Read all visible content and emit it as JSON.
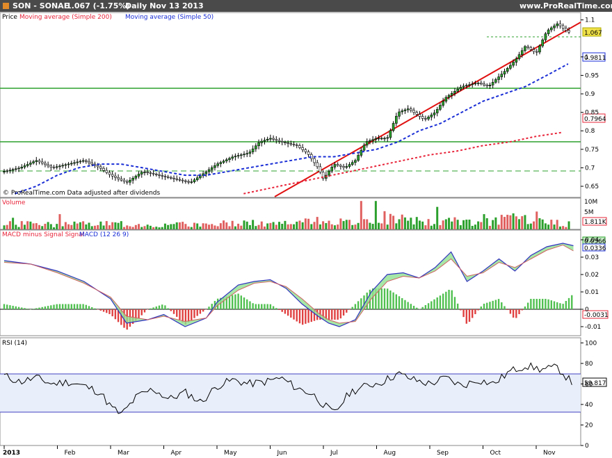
{
  "header": {
    "symbol": "SON - SONAE",
    "quote": "1.067  (-1.75%)",
    "period": "Daily  Nov 13 2013",
    "site": "www.ProRealTime.com"
  },
  "price_panel": {
    "legend_price": "Price",
    "legend_ma200": "Moving average (Simple 200)",
    "legend_ma50": "Moving average (Simple 50)",
    "footer": "© ProRealTime.com  Data adjusted after dividends",
    "last_price": "1.067",
    "ma50_value": "0.9811",
    "ma200_value": "0.7964",
    "yticks": [
      "1.1",
      "1",
      "0.95",
      "0.9",
      "0.85",
      "0.8",
      "0.75",
      "0.7",
      "0.65"
    ]
  },
  "volume_panel": {
    "label": "Volume",
    "tick_top": "10M",
    "tick_mid": "5M",
    "last_value": "1.811K"
  },
  "macd_panel": {
    "label_a": "MACD minus Signal Signal",
    "label_b": "MACD (12 26 9)",
    "value_macd": "0.0366",
    "value_signal": "0.0336",
    "value_hist": "-0.0031",
    "yticks": [
      "0.04",
      "0.03",
      "0.02",
      "0.01",
      "0",
      "-0.01"
    ]
  },
  "rsi_panel": {
    "label": "RSI (14)",
    "last_value": "59.817",
    "yticks": [
      "100",
      "80",
      "60",
      "40",
      "20",
      "0"
    ]
  },
  "x_axis": {
    "labels": [
      "2013",
      "Feb",
      "Mar",
      "Apr",
      "May",
      "Jun",
      "Jul",
      "Aug",
      "Sep",
      "Oct",
      "Nov"
    ]
  },
  "colors": {
    "up": "#2ca02c",
    "down": "#ffffff",
    "ma200": "#e8243a",
    "ma50": "#1a2ed6",
    "trend": "#e01010",
    "level": "#2ca02c",
    "panel_bg": "#e8eefa"
  },
  "chart_data": [
    {
      "type": "line",
      "panel": "price",
      "x_unit": "month of 2013 (0 = Jan 1, 10 = Nov 1)",
      "ylim": [
        0.62,
        1.12
      ],
      "series": [
        {
          "name": "Price",
          "x": [
            0,
            0.3,
            0.6,
            0.9,
            1.2,
            1.5,
            1.8,
            2.0,
            2.3,
            2.6,
            2.9,
            3.2,
            3.5,
            3.8,
            4.0,
            4.3,
            4.6,
            4.8,
            5.0,
            5.2,
            5.5,
            5.7,
            5.9,
            6.0,
            6.2,
            6.4,
            6.6,
            6.8,
            7.0,
            7.2,
            7.4,
            7.6,
            7.9,
            8.1,
            8.3,
            8.6,
            8.9,
            9.1,
            9.4,
            9.6,
            9.8,
            10.0,
            10.2,
            10.4,
            10.6
          ],
          "y": [
            0.69,
            0.7,
            0.72,
            0.7,
            0.71,
            0.72,
            0.7,
            0.68,
            0.66,
            0.69,
            0.68,
            0.67,
            0.66,
            0.69,
            0.71,
            0.73,
            0.74,
            0.77,
            0.78,
            0.77,
            0.76,
            0.74,
            0.7,
            0.67,
            0.71,
            0.7,
            0.72,
            0.77,
            0.78,
            0.78,
            0.85,
            0.86,
            0.83,
            0.85,
            0.89,
            0.92,
            0.93,
            0.92,
            0.96,
            0.99,
            1.03,
            1.01,
            1.07,
            1.09,
            1.067
          ]
        },
        {
          "name": "Moving average (Simple 50)",
          "x": [
            0.2,
            0.6,
            1.0,
            1.4,
            1.8,
            2.2,
            2.6,
            3.0,
            3.4,
            3.8,
            4.2,
            4.6,
            5.0,
            5.4,
            5.8,
            6.2,
            6.6,
            7.0,
            7.4,
            7.8,
            8.2,
            8.6,
            9.0,
            9.4,
            9.8,
            10.2,
            10.6
          ],
          "y": [
            0.63,
            0.65,
            0.68,
            0.7,
            0.71,
            0.71,
            0.7,
            0.69,
            0.68,
            0.68,
            0.69,
            0.7,
            0.71,
            0.72,
            0.73,
            0.73,
            0.74,
            0.75,
            0.77,
            0.8,
            0.82,
            0.85,
            0.88,
            0.9,
            0.92,
            0.95,
            0.981
          ]
        },
        {
          "name": "Moving average (Simple 200)",
          "x": [
            4.5,
            5.0,
            5.5,
            6.0,
            6.5,
            7.0,
            7.5,
            8.0,
            8.5,
            9.0,
            9.5,
            10.0,
            10.5
          ],
          "y": [
            0.63,
            0.645,
            0.66,
            0.675,
            0.69,
            0.705,
            0.72,
            0.735,
            0.745,
            0.76,
            0.77,
            0.785,
            0.796
          ]
        }
      ]
    },
    {
      "type": "bar",
      "panel": "volume",
      "x_unit": "month of 2013",
      "x": [
        0,
        0.5,
        1,
        1.5,
        2,
        2.5,
        3,
        3.5,
        4,
        4.5,
        5,
        5.5,
        6,
        6.5,
        7,
        7.5,
        8,
        8.5,
        9,
        9.5,
        10,
        10.5
      ],
      "values": [
        1.8,
        2.2,
        1.6,
        1.9,
        2.0,
        1.7,
        1.5,
        1.8,
        2.1,
        2.5,
        1.9,
        2.3,
        3.0,
        2.4,
        5.0,
        3.2,
        2.6,
        2.8,
        3.0,
        3.6,
        4.5,
        1.811
      ]
    },
    {
      "type": "line",
      "panel": "macd",
      "x_unit": "month of 2013",
      "ylim": [
        -0.013,
        0.042
      ],
      "series": [
        {
          "name": "MACD (12 26 9)",
          "x": [
            0,
            0.5,
            1,
            1.5,
            2,
            2.3,
            2.7,
            3,
            3.4,
            3.8,
            4,
            4.4,
            4.7,
            5,
            5.3,
            5.6,
            5.9,
            6.1,
            6.3,
            6.6,
            6.9,
            7.2,
            7.5,
            7.8,
            8.1,
            8.4,
            8.7,
            9,
            9.3,
            9.6,
            9.9,
            10.2,
            10.5,
            10.7
          ],
          "y": [
            0.028,
            0.026,
            0.022,
            0.016,
            0.006,
            -0.008,
            -0.006,
            -0.003,
            -0.01,
            -0.005,
            0.004,
            0.014,
            0.016,
            0.017,
            0.012,
            0.003,
            -0.004,
            -0.008,
            -0.01,
            -0.006,
            0.01,
            0.02,
            0.021,
            0.018,
            0.024,
            0.033,
            0.016,
            0.022,
            0.029,
            0.022,
            0.031,
            0.036,
            0.038,
            0.0366
          ]
        },
        {
          "name": "Signal",
          "x": [
            0,
            0.5,
            1,
            1.5,
            2,
            2.3,
            2.7,
            3,
            3.4,
            3.8,
            4,
            4.4,
            4.7,
            5,
            5.3,
            5.6,
            5.9,
            6.1,
            6.3,
            6.6,
            6.9,
            7.2,
            7.5,
            7.8,
            8.1,
            8.4,
            8.7,
            9,
            9.3,
            9.6,
            9.9,
            10.2,
            10.5,
            10.7
          ],
          "y": [
            0.027,
            0.026,
            0.021,
            0.015,
            0.007,
            -0.004,
            -0.006,
            -0.004,
            -0.007,
            -0.005,
            0.002,
            0.011,
            0.015,
            0.016,
            0.013,
            0.006,
            -0.002,
            -0.006,
            -0.008,
            -0.007,
            0.006,
            0.016,
            0.019,
            0.018,
            0.022,
            0.029,
            0.019,
            0.021,
            0.027,
            0.024,
            0.029,
            0.034,
            0.037,
            0.0336
          ]
        }
      ]
    },
    {
      "type": "line",
      "panel": "rsi",
      "x_unit": "month of 2013",
      "ylim": [
        0,
        100
      ],
      "levels": [
        30,
        70
      ],
      "series": [
        {
          "name": "RSI (14)",
          "x": [
            0,
            0.3,
            0.6,
            0.9,
            1.2,
            1.5,
            1.8,
            2.0,
            2.2,
            2.5,
            2.8,
            3.1,
            3.4,
            3.7,
            4.0,
            4.3,
            4.6,
            4.9,
            5.2,
            5.5,
            5.8,
            6.0,
            6.2,
            6.5,
            6.8,
            7.1,
            7.4,
            7.7,
            8.0,
            8.3,
            8.6,
            8.9,
            9.2,
            9.5,
            9.8,
            10.1,
            10.4,
            10.7
          ],
          "y": [
            68,
            62,
            66,
            60,
            62,
            58,
            52,
            38,
            30,
            48,
            55,
            45,
            52,
            42,
            58,
            64,
            60,
            62,
            66,
            56,
            50,
            40,
            31,
            52,
            58,
            62,
            70,
            64,
            60,
            66,
            58,
            64,
            60,
            72,
            78,
            74,
            76,
            59.817
          ]
        }
      ]
    }
  ]
}
